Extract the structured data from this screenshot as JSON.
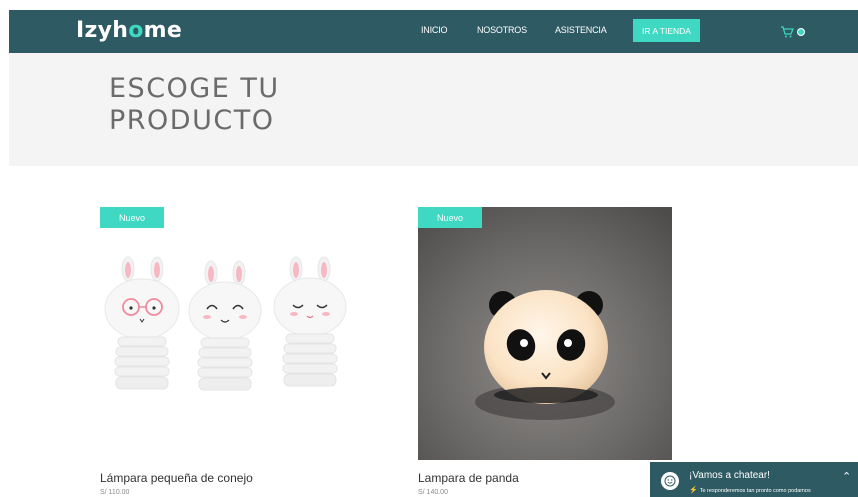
{
  "brand": {
    "logo_prefix": "Izyh",
    "logo_o": "o",
    "logo_suffix": "me",
    "accent_color": "#3fd8c2",
    "header_color": "#2e5a63"
  },
  "nav": {
    "items": [
      {
        "label": "INICIO"
      },
      {
        "label": "NOSOTROS"
      },
      {
        "label": "ASISTENCIA"
      }
    ],
    "cta_label": "IR A TIENDA",
    "cart_icon": "cart-icon"
  },
  "hero": {
    "title_line1": "ESCOGE TU",
    "title_line2": "PRODUCTO"
  },
  "products": [
    {
      "badge": "Nuevo",
      "name": "Lámpara pequeña de conejo",
      "price": "S/ 110.00"
    },
    {
      "badge": "Nuevo",
      "name": "Lampara de panda",
      "price": "S/ 140.00"
    }
  ],
  "chat": {
    "title": "¡Vamos a chatear!",
    "subtitle": "Te responderemos tan pronto como podamos",
    "toggle_icon": "chevron-up-icon"
  }
}
